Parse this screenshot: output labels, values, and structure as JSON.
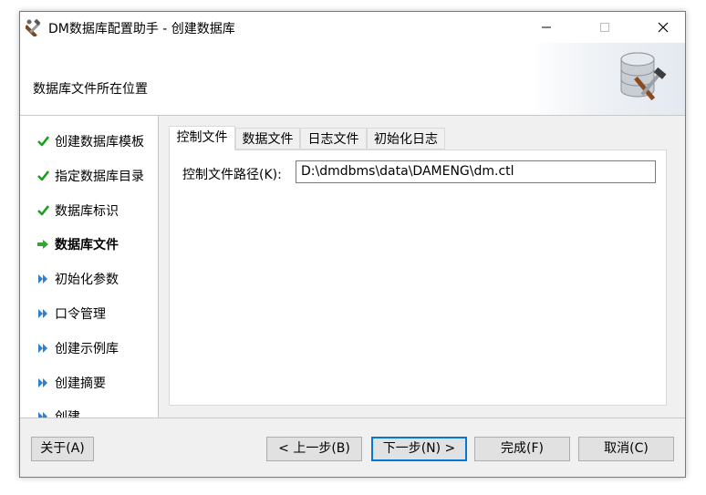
{
  "window": {
    "title": "DM数据库配置助手 - 创建数据库"
  },
  "header": {
    "subtitle": "数据库文件所在位置"
  },
  "sidebar": {
    "steps": [
      {
        "label": "创建数据库模板",
        "status": "done",
        "icon": "check-icon"
      },
      {
        "label": "指定数据库目录",
        "status": "done",
        "icon": "check-icon"
      },
      {
        "label": "数据库标识",
        "status": "done",
        "icon": "check-icon"
      },
      {
        "label": "数据库文件",
        "status": "current",
        "icon": "arrow-right-icon"
      },
      {
        "label": "初始化参数",
        "status": "pending",
        "icon": "double-chevron-icon"
      },
      {
        "label": "口令管理",
        "status": "pending",
        "icon": "double-chevron-icon"
      },
      {
        "label": "创建示例库",
        "status": "pending",
        "icon": "double-chevron-icon"
      },
      {
        "label": "创建摘要",
        "status": "pending",
        "icon": "double-chevron-icon"
      },
      {
        "label": "创建",
        "status": "pending",
        "icon": "double-chevron-icon"
      }
    ]
  },
  "tabs": [
    {
      "label": "控制文件",
      "active": true
    },
    {
      "label": "数据文件",
      "active": false
    },
    {
      "label": "日志文件",
      "active": false
    },
    {
      "label": "初始化日志",
      "active": false
    }
  ],
  "control_file": {
    "label": "控制文件路径(K):",
    "value": "D:\\dmdbms\\data\\DAMENG\\dm.ctl"
  },
  "footer": {
    "about": "关于(A)",
    "prev": "< 上一步(B)",
    "next": "下一步(N) >",
    "finish": "完成(F)",
    "cancel": "取消(C)"
  },
  "colors": {
    "check": "#1f9d1f",
    "arrow": "#2ea82e",
    "chevron": "#2f7fd3",
    "focus": "#0078d7"
  }
}
